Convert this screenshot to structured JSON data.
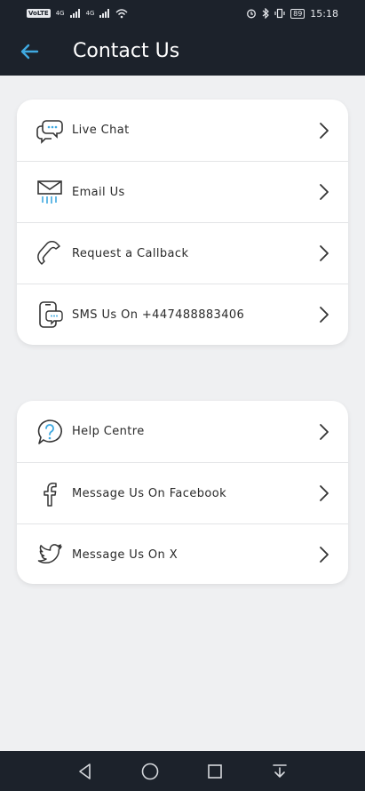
{
  "status_bar": {
    "left_chip": "VoLTE",
    "net1": "4G",
    "net2": "4G",
    "battery": "89",
    "time": "15:18"
  },
  "header": {
    "title": "Contact Us"
  },
  "contact_group": [
    {
      "label": "Live Chat",
      "icon": "chat-icon"
    },
    {
      "label": "Email Us",
      "icon": "email-icon"
    },
    {
      "label": "Request a Callback",
      "icon": "phone-icon"
    },
    {
      "label": "SMS Us On +447488883406",
      "icon": "sms-icon"
    }
  ],
  "social_group": [
    {
      "label": "Help Centre",
      "icon": "help-icon"
    },
    {
      "label": "Message Us On Facebook",
      "icon": "facebook-icon"
    },
    {
      "label": "Message Us On X",
      "icon": "twitter-icon"
    }
  ],
  "colors": {
    "accent": "#3fa9e0",
    "bar": "#1c222b"
  }
}
